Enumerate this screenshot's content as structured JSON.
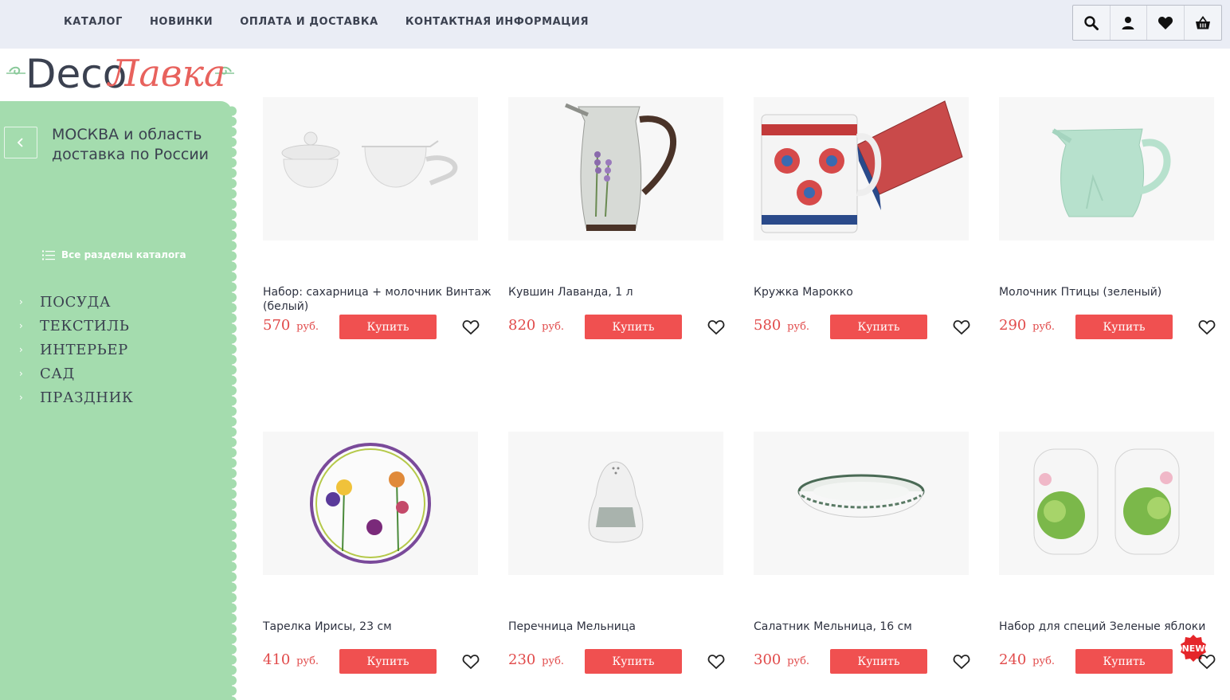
{
  "nav": {
    "items": [
      "КАТАЛОГ",
      "НОВИНКИ",
      "ОПЛАТА И ДОСТАВКА",
      "КОНТАКТНАЯ ИНФОРМАЦИЯ"
    ]
  },
  "header_icons": [
    "search-icon",
    "user-icon",
    "heart-icon",
    "basket-icon"
  ],
  "logo": {
    "text_dark": "Deco",
    "text_red": "Лавка"
  },
  "sidebar": {
    "region_line1": "МОСКВА и область",
    "region_line2": "доставка по России",
    "all_sections": "Все разделы каталога",
    "categories": [
      "ПОСУДА",
      "ТЕКСТИЛЬ",
      "ИНТЕРЬЕР",
      "САД",
      "ПРАЗДНИК"
    ]
  },
  "products": [
    {
      "name": "Набор: сахарница + молочник Винтаж (белый)",
      "price": "570",
      "currency": "руб.",
      "buy": "Купить"
    },
    {
      "name": "Кувшин Лаванда, 1 л",
      "price": "820",
      "currency": "руб.",
      "buy": "Купить"
    },
    {
      "name": "Кружка Марокко",
      "price": "580",
      "currency": "руб.",
      "buy": "Купить"
    },
    {
      "name": "Молочник Птицы (зеленый)",
      "price": "290",
      "currency": "руб.",
      "buy": "Купить"
    },
    {
      "name": "Тарелка Ирисы, 23 см",
      "price": "410",
      "currency": "руб.",
      "buy": "Купить"
    },
    {
      "name": "Перечница Мельница",
      "price": "230",
      "currency": "руб.",
      "buy": "Купить"
    },
    {
      "name": "Салатник Мельница, 16 см",
      "price": "300",
      "currency": "руб.",
      "buy": "Купить"
    },
    {
      "name": "Набор для специй Зеленые яблоки",
      "price": "240",
      "currency": "руб.",
      "buy": "Купить",
      "badge": "NEW"
    }
  ],
  "colors": {
    "accent": "#f05050",
    "price": "#e14b4b",
    "sidebar": "#a4dcae",
    "topbar": "#eaedf5",
    "text": "#3b4150"
  }
}
